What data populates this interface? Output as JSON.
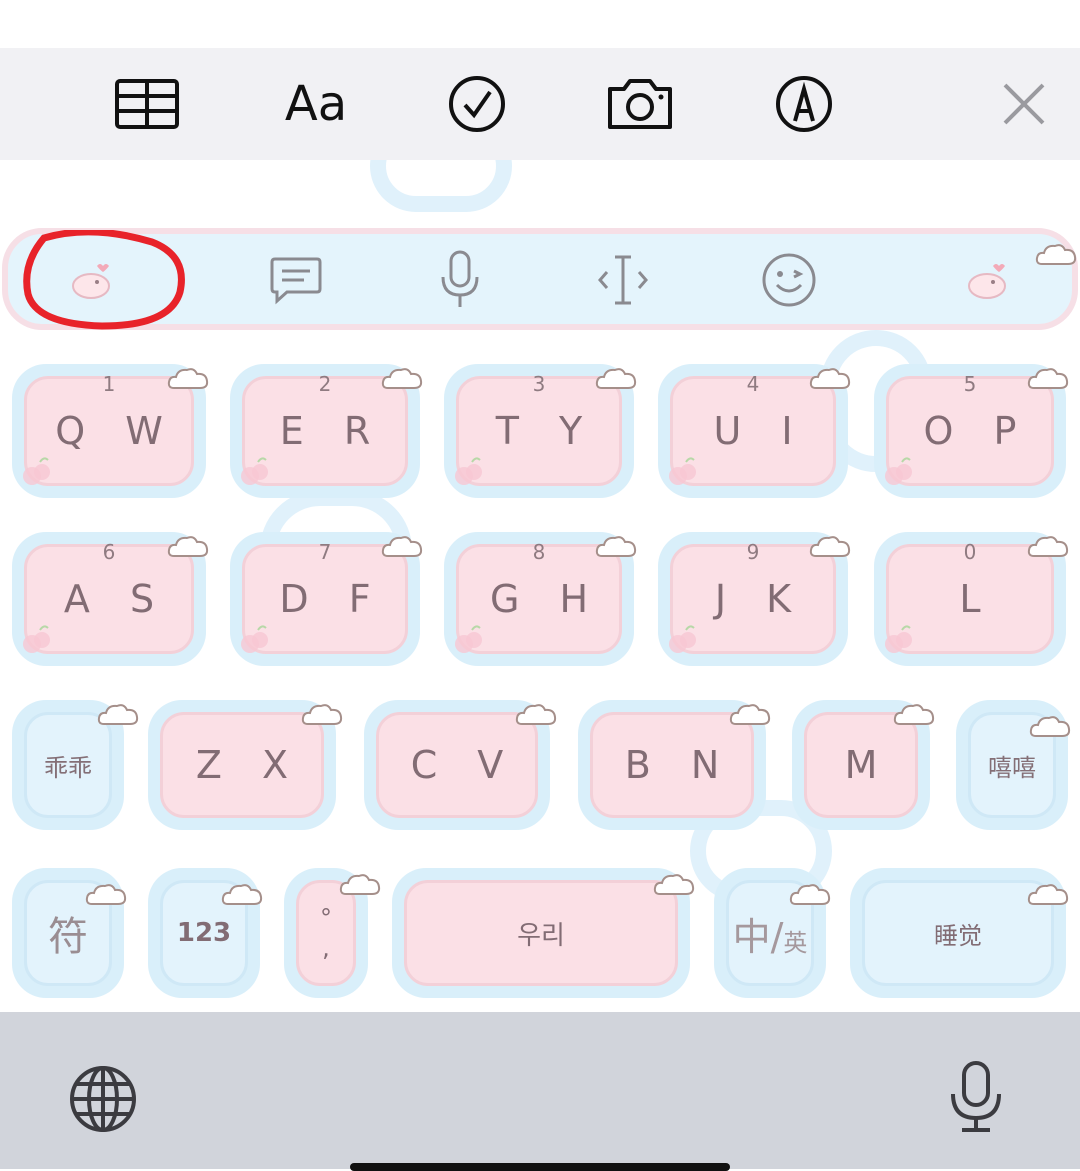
{
  "toolbar": {
    "icons": [
      "table-icon",
      "text-format-icon",
      "checklist-icon",
      "camera-icon",
      "markup-icon",
      "close-icon"
    ],
    "text_format_label": "Aa"
  },
  "suggestion_bar": {
    "icons": [
      "skin-icon",
      "message-icon",
      "mic-icon",
      "cursor-icon",
      "emoji-icon",
      "skin-icon-right"
    ]
  },
  "rows": [
    [
      {
        "num": "1",
        "label": "Q W"
      },
      {
        "num": "2",
        "label": "E R"
      },
      {
        "num": "3",
        "label": "T Y"
      },
      {
        "num": "4",
        "label": "U I"
      },
      {
        "num": "5",
        "label": "O P"
      }
    ],
    [
      {
        "num": "6",
        "label": "A S"
      },
      {
        "num": "7",
        "label": "D F"
      },
      {
        "num": "8",
        "label": "G H"
      },
      {
        "num": "9",
        "label": "J K"
      },
      {
        "num": "0",
        "label": "L"
      }
    ]
  ],
  "row3": {
    "left": "乖乖",
    "keys": [
      "Z X",
      "C V",
      "B N",
      "M"
    ],
    "right": "嘻嘻"
  },
  "row4": {
    "symbol": "符",
    "numbers": "123",
    "punct_top": "°",
    "punct_bottom": ",",
    "space": "우리",
    "lang_main": "中/",
    "lang_sub": "英",
    "enter": "睡觉"
  },
  "bottom_bar": {
    "icons": [
      "globe-icon",
      "dictation-mic-icon"
    ]
  },
  "annotation": {
    "color": "#e8232a"
  }
}
